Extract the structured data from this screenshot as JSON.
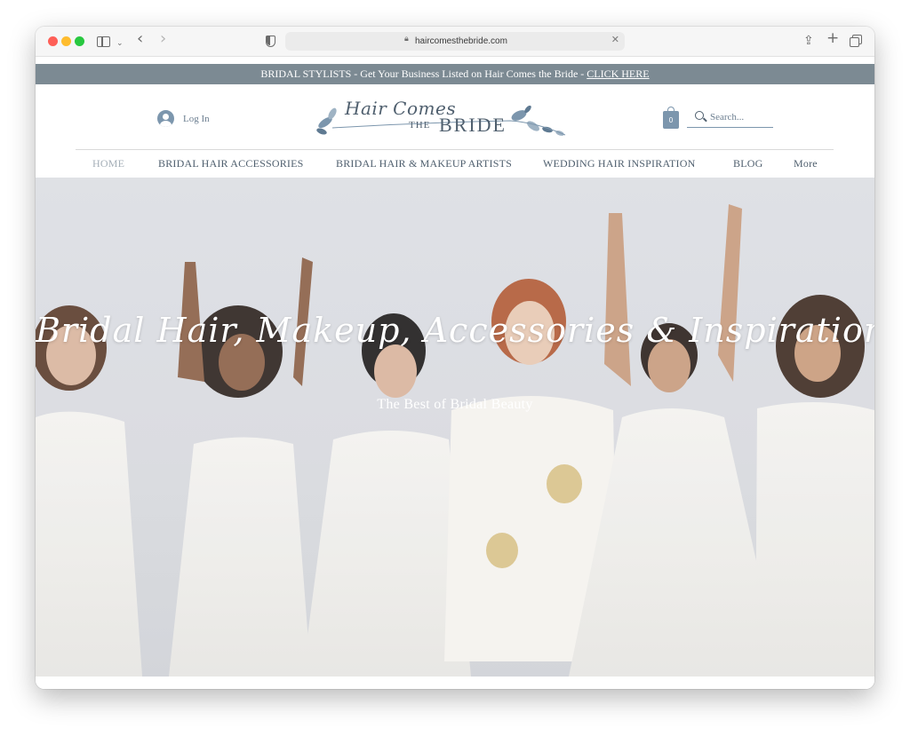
{
  "browser": {
    "url": "haircomesthebride.com"
  },
  "announcement": {
    "text": "BRIDAL STYLISTS - Get Your Business Listed on Hair Comes the Bride - ",
    "link_text": "CLICK HERE"
  },
  "header": {
    "login_label": "Log In",
    "logo": {
      "script_text": "Hair Comes",
      "the_text": "THE",
      "bride_text": "BRIDE"
    },
    "cart_count": "0",
    "search_placeholder": "Search..."
  },
  "nav": {
    "items": [
      {
        "label": "HOME",
        "active": true
      },
      {
        "label": "BRIDAL HAIR ACCESSORIES"
      },
      {
        "label": "BRIDAL HAIR & MAKEUP ARTISTS"
      },
      {
        "label": "WEDDING HAIR INSPIRATION"
      },
      {
        "label": "BLOG"
      },
      {
        "label": "More"
      }
    ]
  },
  "hero": {
    "title": "Bridal Hair, Makeup, Accessories & Inspiration",
    "subtitle": "The Best of Bridal Beauty"
  },
  "colors": {
    "accent": "#7c96ad",
    "announce_bg": "#7c8a93",
    "text": "#4f5f6e"
  }
}
